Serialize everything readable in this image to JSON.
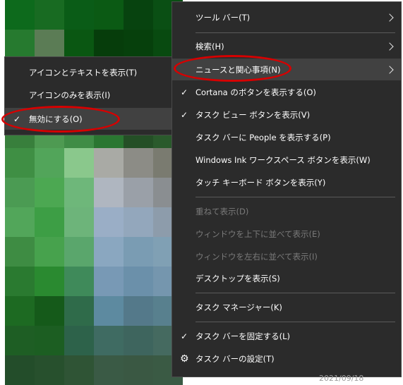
{
  "colors": {
    "menu_bg": "#2b2b2b",
    "highlight": "#414141",
    "annotation": "#d60000"
  },
  "main_menu": {
    "items": [
      {
        "label": "ツール バー(T)",
        "submenu": true
      },
      {
        "label": "検索(H)",
        "submenu": true
      },
      {
        "label": "ニュースと関心事項(N)",
        "submenu": true,
        "highlighted": true
      },
      {
        "label": "Cortana のボタンを表示する(O)",
        "checked": true
      },
      {
        "label": "タスク ビュー ボタンを表示(V)",
        "checked": true
      },
      {
        "label": "タスク バーに People を表示する(P)"
      },
      {
        "label": "Windows Ink ワークスペース ボタンを表示(W)"
      },
      {
        "label": "タッチ キーボード ボタンを表示(Y)"
      },
      {
        "label": "重ねて表示(D)",
        "disabled": true
      },
      {
        "label": "ウィンドウを上下に並べて表示(E)",
        "disabled": true
      },
      {
        "label": "ウィンドウを左右に並べて表示(I)",
        "disabled": true
      },
      {
        "label": "デスクトップを表示(S)"
      },
      {
        "label": "タスク マネージャー(K)"
      },
      {
        "label": "タスク バーを固定する(L)",
        "checked": true
      },
      {
        "label": "タスク バーの設定(T)",
        "icon": "gear-icon"
      }
    ]
  },
  "sub_menu": {
    "items": [
      {
        "label": "アイコンとテキストを表示(T)"
      },
      {
        "label": "アイコンのみを表示(I)"
      },
      {
        "label": "無効にする(O)",
        "checked": true,
        "highlighted": true
      }
    ]
  },
  "taskbar_date": "2021/09/18"
}
